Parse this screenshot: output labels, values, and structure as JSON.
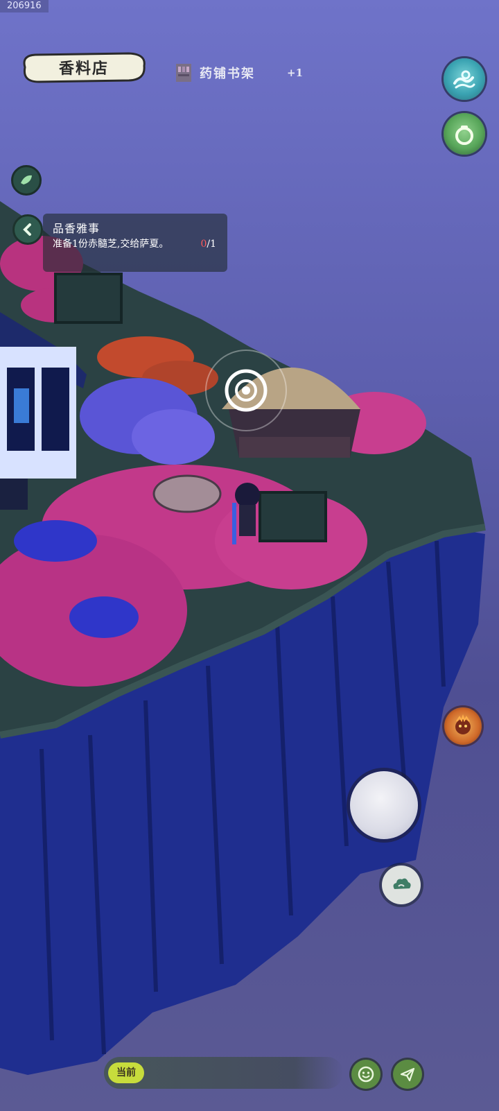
{
  "overlay": {
    "id_text": "206916"
  },
  "location": {
    "name": "香料店"
  },
  "item_toast": {
    "icon": "bookshelf-icon",
    "name": "药铺书架",
    "count": "+1"
  },
  "quest": {
    "title": "品香雅事",
    "description": "准备1份赤髓芝,交给萨夏。",
    "progress_current": "0",
    "progress_total": "/1"
  },
  "chat": {
    "channel_label": "当前"
  },
  "buttons": {
    "top_right": [
      "water-wave-icon",
      "pot-icon"
    ],
    "left": [
      "leaf-icon",
      "back-arrow-icon"
    ],
    "right": [
      "spirit-icon",
      "joystick",
      "cloud-icon"
    ],
    "bottom": [
      "emoji-icon",
      "send-icon"
    ]
  },
  "colors": {
    "sky_top": "#6f73c9",
    "sky_mid": "#5d5fae",
    "cliff": "#1f2e8f",
    "flowers_pink": "#d94f9a",
    "flowers_blue": "#5a5fe0",
    "quest_progress": "#ff5b5b",
    "chat_tag": "#c7dc3c"
  }
}
